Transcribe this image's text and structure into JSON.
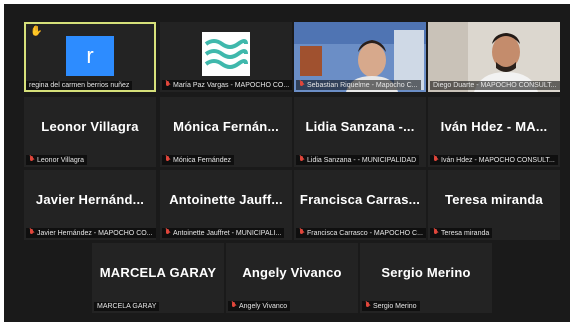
{
  "tiles": [
    {
      "big": "",
      "label": "regina del carmen berrios nuñez",
      "mic": false,
      "kind": "avatar",
      "avatar_letter": "r",
      "active": true,
      "hand": true
    },
    {
      "big": "",
      "label": "María Paz Vargas - MAPOCHO CO...",
      "mic": true,
      "kind": "logo"
    },
    {
      "big": "",
      "label": "Sebastian Riquelme - Mapocho C...",
      "mic": true,
      "kind": "video1"
    },
    {
      "big": "",
      "label": "Diego Duarte - MAPOCHO CONSULT...",
      "mic": false,
      "kind": "video2"
    },
    {
      "big": "Leonor Villagra",
      "label": "Leonor Villagra",
      "mic": true
    },
    {
      "big": "Mónica Fernán...",
      "label": "Mónica Fernández",
      "mic": true
    },
    {
      "big": "Lidia Sanzana -...",
      "label": "Lidia Sanzana - - MUNICIPALIDAD",
      "mic": true
    },
    {
      "big": "Iván Hdez - MA...",
      "label": "Iván Hdez - MAPOCHO CONSULT...",
      "mic": true
    },
    {
      "big": "Javier Hernánd...",
      "label": "Javier Hernández - MAPOCHO CO...",
      "mic": true
    },
    {
      "big": "Antoinette Jauff...",
      "label": "Antoinette Jauffret - MUNICIPALI...",
      "mic": true
    },
    {
      "big": "Francisca Carras...",
      "label": "Francisca Carrasco - MAPOCHO C...",
      "mic": true
    },
    {
      "big": "Teresa miranda",
      "label": "Teresa miranda",
      "mic": true
    },
    {
      "big": "MARCELA GARAY",
      "label": "MARCELA GARAY",
      "mic": false
    },
    {
      "big": "Angely Vivanco",
      "label": "Angely Vivanco",
      "mic": true
    },
    {
      "big": "Sergio Merino",
      "label": "Sergio Merino",
      "mic": true
    }
  ],
  "colors": {
    "background": "#1a1a1a",
    "tile": "#232323",
    "active_border": "#d6e07a",
    "avatar": "#2d8cff",
    "muted_mic": "#e0463b"
  },
  "icons": {
    "raised_hand": "raised-hand-icon",
    "muted": "mic-muted-icon"
  }
}
